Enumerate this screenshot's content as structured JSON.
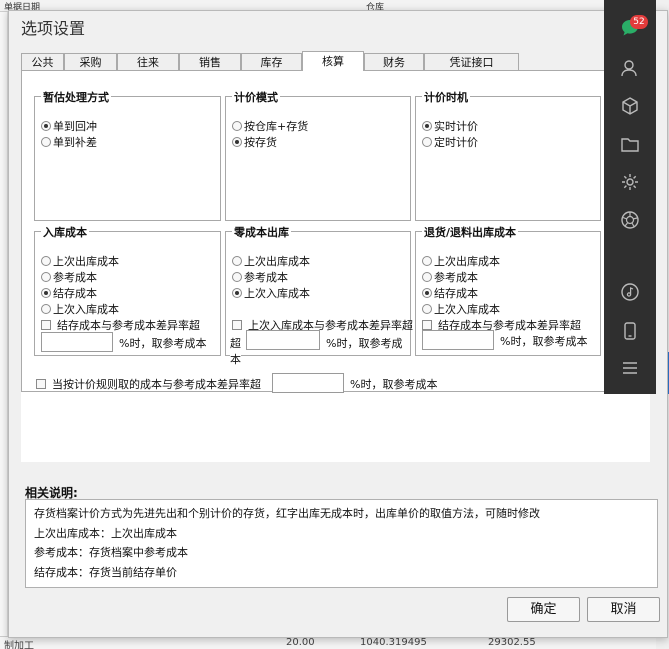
{
  "background": {
    "top_left_text": "单据日期",
    "top_mid_text": "仓库",
    "bottom_left_text": "制加工",
    "bottom_values": [
      "20.00",
      "1040.319495",
      "29302.55"
    ]
  },
  "dialog": {
    "title": "选项设置",
    "tabs": [
      {
        "label": "公共"
      },
      {
        "label": "采购"
      },
      {
        "label": "往来"
      },
      {
        "label": "销售"
      },
      {
        "label": "库存"
      },
      {
        "label": "核算"
      },
      {
        "label": "财务"
      },
      {
        "label": "凭证接口"
      }
    ],
    "groups": {
      "estimate": {
        "title": "暂估处理方式",
        "options": [
          "单到回冲",
          "单到补差"
        ],
        "selected": 0
      },
      "pricing_mode": {
        "title": "计价模式",
        "options": [
          "按仓库+存货",
          "按存货"
        ],
        "selected": 1
      },
      "pricing_timing": {
        "title": "计价时机",
        "options": [
          "实时计价",
          "定时计价"
        ],
        "selected": 0
      },
      "inbound_cost": {
        "title": "入库成本",
        "options": [
          "上次出库成本",
          "参考成本",
          "结存成本",
          "上次入库成本"
        ],
        "selected": 2,
        "check_label": "结存成本与参考成本差异率超",
        "suffix": "%时，取参考成本"
      },
      "zero_cost_out": {
        "title": "零成本出库",
        "options": [
          "上次出库成本",
          "参考成本",
          "上次入库成本"
        ],
        "selected": 2,
        "check_label": "上次入库成本与参考成本差异率超",
        "prefix": "超",
        "suffix": "%时，取参考成",
        "wrap": "本"
      },
      "return_cost": {
        "title": "退货/退料出库成本",
        "options": [
          "上次出库成本",
          "参考成本",
          "结存成本",
          "上次入库成本"
        ],
        "selected": 2,
        "check_label": "结存成本与参考成本差异率超",
        "suffix": "%时，取参考成本"
      }
    },
    "bottom_check": {
      "label": "当按计价规则取的成本与参考成本差异率超",
      "suffix": "%时，取参考成本"
    },
    "description": {
      "title": "相关说明:",
      "lines": [
        "存货档案计价方式为先进先出和个别计价的存货，红字出库无成本时，出库单价的取值方法，可随时修改",
        "上次出库成本：上次出库成本",
        "参考成本：存货档案中参考成本",
        "结存成本：存货当前结存单价"
      ]
    },
    "buttons": {
      "ok": "确定",
      "cancel": "取消"
    }
  },
  "sidebar": {
    "badge_count": "52",
    "icons": [
      "chat-icon",
      "contacts-icon",
      "cube-icon",
      "folder-icon",
      "settings-icon",
      "aperture-icon",
      "music-icon",
      "phone-icon",
      "menu-icon"
    ]
  },
  "colors": {
    "sidebar_bg": "#2f2f2f",
    "badge": "#e23b3b",
    "chat_green": "#2aae67",
    "accent_blue": "#2e79d6"
  }
}
